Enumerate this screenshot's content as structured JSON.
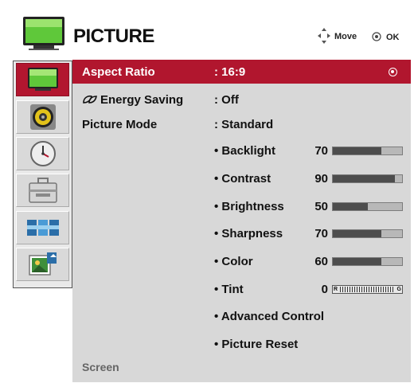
{
  "header": {
    "title": "PICTURE",
    "move_label": "Move",
    "ok_label": "OK",
    "icon": "tv-icon"
  },
  "rail": {
    "items": [
      {
        "icon": "picture-tv-icon",
        "selected": true
      },
      {
        "icon": "audio-speaker-icon",
        "selected": false
      },
      {
        "icon": "time-clock-icon",
        "selected": false
      },
      {
        "icon": "option-toolbox-icon",
        "selected": false
      },
      {
        "icon": "input-list-icon",
        "selected": false
      },
      {
        "icon": "usb-media-icon",
        "selected": false
      }
    ]
  },
  "menu": {
    "aspect_ratio": {
      "label": "Aspect Ratio",
      "value": ": 16:9"
    },
    "energy_saving": {
      "label": "Energy Saving",
      "value": ": Off"
    },
    "picture_mode": {
      "label": "Picture Mode",
      "value": ": Standard"
    },
    "sliders": [
      {
        "label": "• Backlight",
        "value": "70",
        "fraction": 0.7
      },
      {
        "label": "• Contrast",
        "value": "90",
        "fraction": 0.9
      },
      {
        "label": "• Brightness",
        "value": "50",
        "fraction": 0.5
      },
      {
        "label": "• Sharpness",
        "value": "70",
        "fraction": 0.7
      },
      {
        "label": "• Color",
        "value": "60",
        "fraction": 0.7
      }
    ],
    "tint": {
      "label": "• Tint",
      "value": "0",
      "left_mark": "R",
      "right_mark": "G"
    },
    "advanced_control": "• Advanced Control",
    "picture_reset": "• Picture Reset",
    "screen": "Screen"
  },
  "colors": {
    "selection": "#b1162e",
    "panel": "#d8d8d8",
    "bar_fill": "#4d4d4d"
  }
}
